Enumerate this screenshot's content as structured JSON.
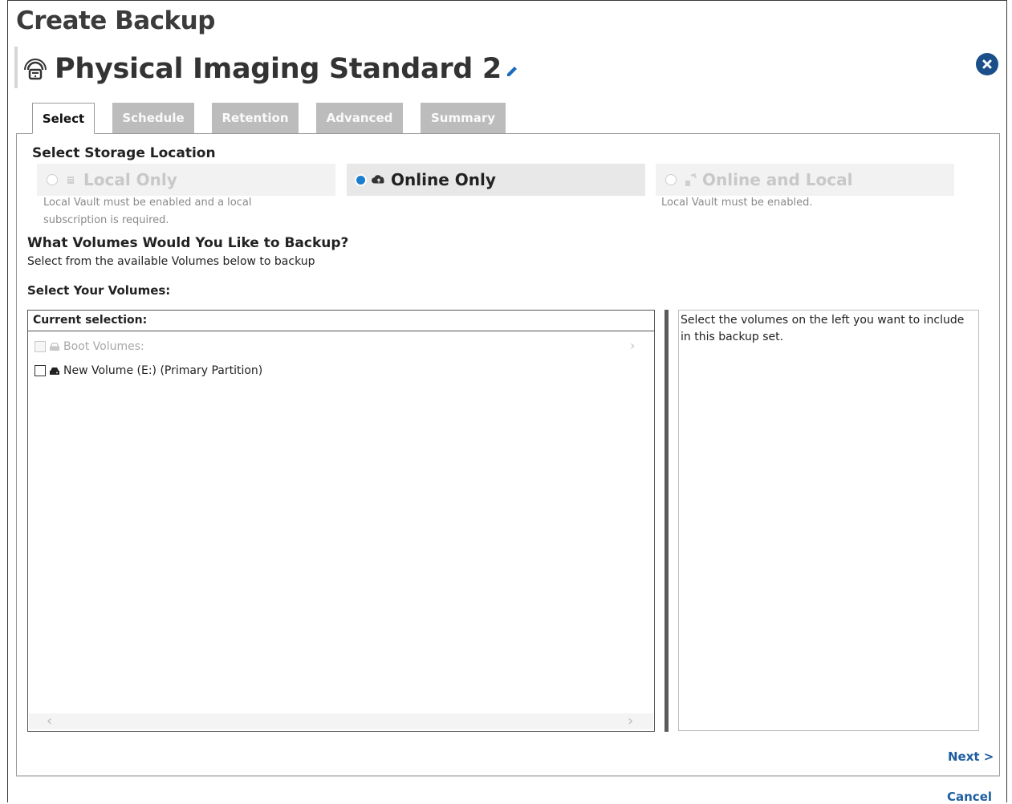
{
  "page": {
    "title": "Create Backup"
  },
  "plan": {
    "name": "Physical Imaging Standard 2"
  },
  "tabs": [
    {
      "label": "Select",
      "active": true
    },
    {
      "label": "Schedule",
      "active": false
    },
    {
      "label": "Retention",
      "active": false
    },
    {
      "label": "Advanced",
      "active": false
    },
    {
      "label": "Summary",
      "active": false
    }
  ],
  "storage": {
    "heading": "Select Storage Location",
    "options": [
      {
        "label": "Local Only",
        "state": "disabled",
        "icon": "server-icon",
        "note": "Local Vault must be enabled and a local subscription is required."
      },
      {
        "label": "Online Only",
        "state": "selected",
        "icon": "cloud-icon",
        "note": ""
      },
      {
        "label": "Online and Local",
        "state": "disabled",
        "icon": "sync-icon",
        "note": "Local Vault must be enabled."
      }
    ]
  },
  "volumes": {
    "heading": "What Volumes Would You Like to Backup?",
    "subheading": "Select from the available Volumes below to backup",
    "select_label": "Select Your Volumes:",
    "current_selection_label": "Current selection:",
    "items": [
      {
        "label": "Boot Volumes:",
        "enabled": false,
        "checked": false
      },
      {
        "label": "New Volume (E:) (Primary Partition)",
        "enabled": true,
        "checked": false
      }
    ],
    "help_text": "Select the volumes on the left you want to include in this backup set."
  },
  "footer": {
    "next_label": "Next >",
    "cancel_label": "Cancel"
  },
  "colors": {
    "accent": "#1a7dd0",
    "link": "#1f5ea0",
    "close_button": "#1a4f8a",
    "tab_inactive": "#bcbcbc"
  }
}
